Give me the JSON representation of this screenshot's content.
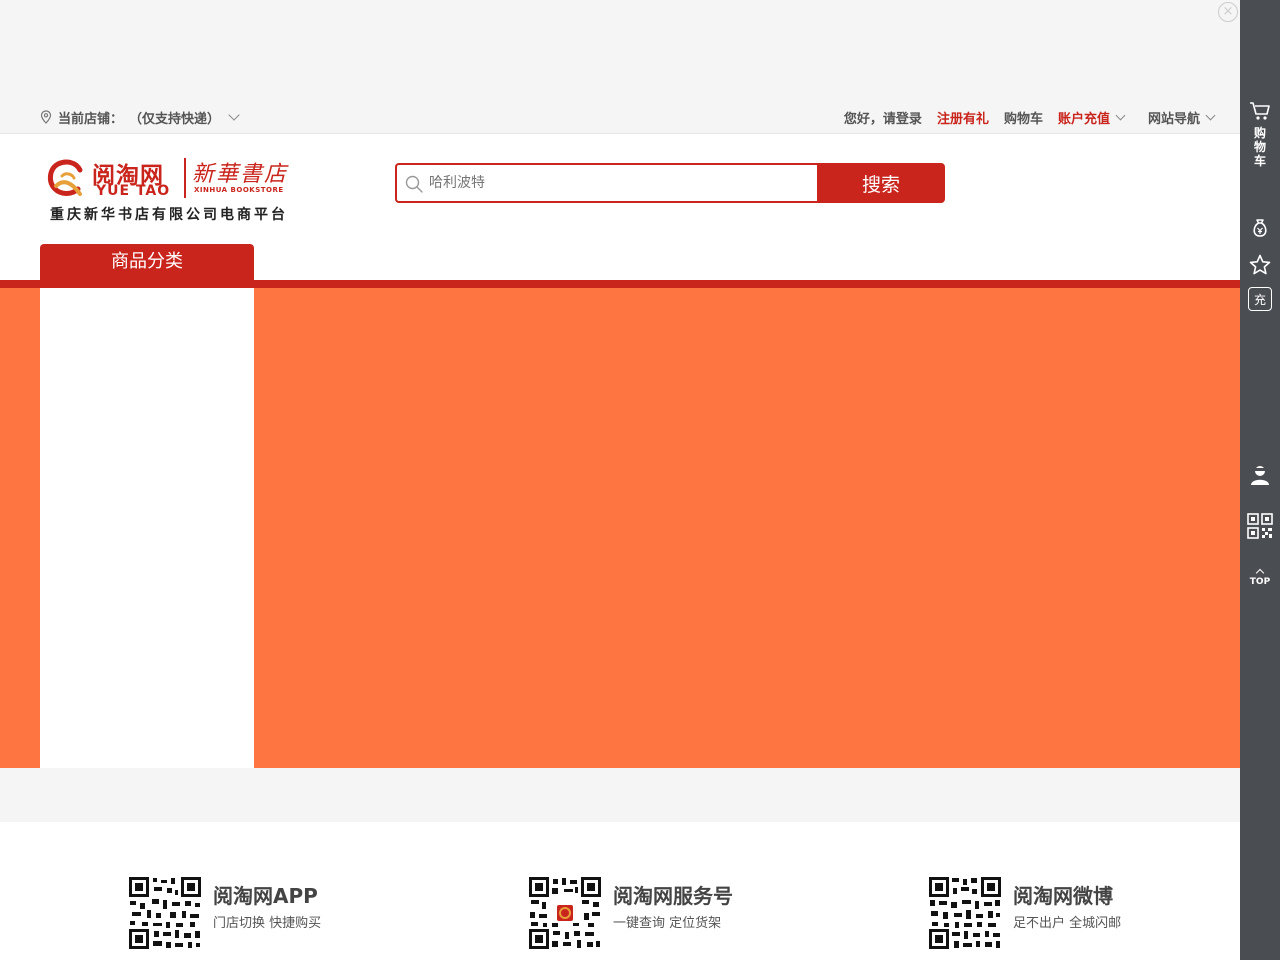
{
  "ad": {
    "close_icon": "×"
  },
  "topbar": {
    "store_label": "当前店铺：",
    "store_value": "（仅支持快递）",
    "greeting": "您好，请登录",
    "register": "注册有礼",
    "cart": "购物车",
    "recharge": "账户充值",
    "site_nav": "网站导航"
  },
  "logo": {
    "name_cn": "阅淘网",
    "name_en": "YUE TAO",
    "xinhua": "新華書店",
    "xinhua_en": "XINHUA BOOKSTORE",
    "tagline": "重庆新华书店有限公司电商平台"
  },
  "search": {
    "placeholder": "哈利波特",
    "button": "搜索"
  },
  "category_tab": "商品分类",
  "footer": {
    "items": [
      {
        "title": "阅淘网APP",
        "desc": "门店切换 快捷购买"
      },
      {
        "title": "阅淘网服务号",
        "desc": "一键查询 定位货架"
      },
      {
        "title": "阅淘网微博",
        "desc": "足不出户 全城闪邮"
      }
    ]
  },
  "sidebar": {
    "cart_label": "购物车",
    "recharge_label": "充",
    "top_label": "TOP"
  },
  "colors": {
    "brand_red": "#c9251d",
    "banner_orange": "#ff7542",
    "sidebar_gray": "#4a4d52"
  }
}
